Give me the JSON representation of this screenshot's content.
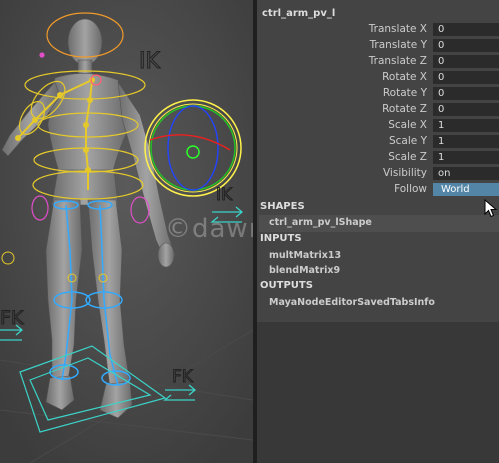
{
  "viewport": {
    "labels": {
      "ik_top": "IK",
      "ik_side": "IK",
      "fk_left": "FK",
      "fk_right": "FK"
    },
    "watermark": "©dawnarc",
    "colors": {
      "body": "#808080",
      "joint": "#e5c92a",
      "ik_ring": "#fff24a",
      "fk_leg": "#33aaff",
      "pink_ctrl": "#e04fc7",
      "cyan_ctrl": "#3bd3c8"
    }
  },
  "panel": {
    "node_name": "ctrl_arm_pv_l",
    "attributes": [
      {
        "label": "Translate X",
        "value": "0"
      },
      {
        "label": "Translate Y",
        "value": "0"
      },
      {
        "label": "Translate Z",
        "value": "0"
      },
      {
        "label": "Rotate X",
        "value": "0"
      },
      {
        "label": "Rotate Y",
        "value": "0"
      },
      {
        "label": "Rotate Z",
        "value": "0"
      },
      {
        "label": "Scale X",
        "value": "1"
      },
      {
        "label": "Scale Y",
        "value": "1"
      },
      {
        "label": "Scale Z",
        "value": "1"
      },
      {
        "label": "Visibility",
        "value": "on"
      },
      {
        "label": "Follow",
        "value": "World"
      }
    ],
    "shapes": {
      "title": "SHAPES",
      "items": [
        "ctrl_arm_pv_lShape"
      ]
    },
    "inputs": {
      "title": "INPUTS",
      "items": [
        "multMatrix13",
        "blendMatrix9"
      ]
    },
    "outputs": {
      "title": "OUTPUTS",
      "items": [
        "MayaNodeEditorSavedTabsInfo"
      ]
    }
  }
}
